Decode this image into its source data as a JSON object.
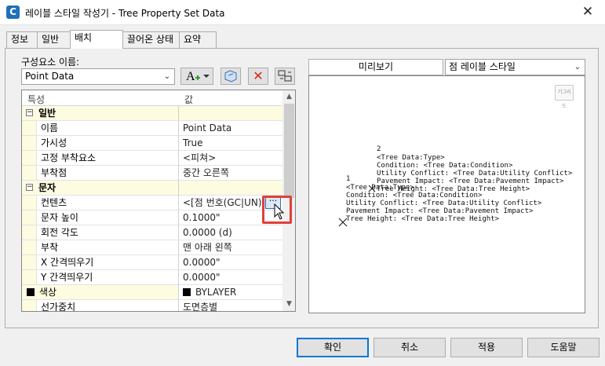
{
  "window": {
    "title": "레이블 스타일 작성기 - Tree Property Set Data",
    "close_glyph": "✕",
    "app_icon_glyph": "C"
  },
  "tabs": [
    {
      "label": "정보"
    },
    {
      "label": "일반"
    },
    {
      "label": "배치"
    },
    {
      "label": "끌어온 상태"
    },
    {
      "label": "요약"
    }
  ],
  "active_tab": "배치",
  "component": {
    "label": "구성요소 이름:",
    "value": "Point Data",
    "arrow": "⌄"
  },
  "toolbar": {
    "add_glyph": "A",
    "add_arrow": "▾",
    "delete_glyph": "✕"
  },
  "grid": {
    "headers": {
      "property": "특성",
      "value": "값"
    },
    "rows": [
      {
        "kind": "cat",
        "toggle": "−",
        "label": "일반",
        "value": ""
      },
      {
        "kind": "prop",
        "label": "이름",
        "value": "Point Data"
      },
      {
        "kind": "prop",
        "label": "가시성",
        "value": "True"
      },
      {
        "kind": "prop",
        "label": "고정 부착요소",
        "value": "<피쳐>"
      },
      {
        "kind": "prop",
        "label": "부착점",
        "value": "중간 오른쪽"
      },
      {
        "kind": "cat",
        "toggle": "−",
        "label": "문자",
        "value": ""
      },
      {
        "kind": "prop",
        "label": "컨텐츠",
        "value": "<[점 번호(GC|UN)]>"
      },
      {
        "kind": "prop",
        "label": "문자 높이",
        "value": "0.1000\""
      },
      {
        "kind": "prop",
        "label": "회전 각도",
        "value": "0.0000 (d)"
      },
      {
        "kind": "prop",
        "label": "부착",
        "value": "맨 아래 왼쪽"
      },
      {
        "kind": "prop",
        "label": "X 간격띄우기",
        "value": "0.0000\""
      },
      {
        "kind": "prop",
        "label": "Y 간격띄우기",
        "value": "0.0000\""
      },
      {
        "kind": "cat",
        "toggle": "",
        "label": "색상",
        "value": "BYLAYER"
      },
      {
        "kind": "prop",
        "label": "선가중치",
        "value": "도면층별"
      }
    ],
    "ellipsis": "···",
    "scroll_up": "▲",
    "scroll_down": "▼"
  },
  "preview": {
    "title": "미리보기",
    "style_select": "점 레이블 스타일",
    "zoom_label": "기그리드",
    "text_lines": [
      "2",
      "<Tree Data:Type>",
      "Condition: <Tree Data:Condition>",
      "Utility Conflict: <Tree Data:Utility Conflict>",
      "Pavement Impact: <Tree Data:Pavement Impact>",
      "Tree Height: <Tree Data:Tree Height>",
      "1",
      "<Tree Data:Type>",
      "Condition: <Tree Data:Condition>",
      "Utility Conflict: <Tree Data:Utility Conflict>",
      "Pavement Impact: <Tree Data:Pavement Impact>",
      "Tree Height: <Tree Data:Tree Height>"
    ]
  },
  "buttons": {
    "ok": "확인",
    "cancel": "취소",
    "apply": "적용",
    "help": "도움말"
  },
  "colors": {
    "accent": "#0078d7",
    "highlight": "#e0403a",
    "category_bg": "#fdfbe0",
    "delete_red": "#d9261c"
  }
}
